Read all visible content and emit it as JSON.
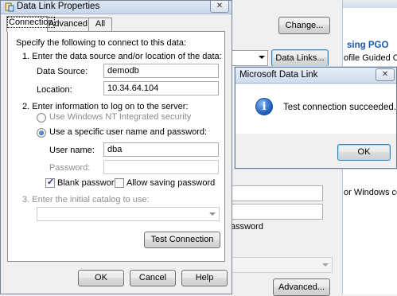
{
  "background": {
    "change_button": "Change...",
    "data_links_button": "Data Links...",
    "advanced_button": "Advanced...",
    "link_heading": "sing PGO",
    "link_text": "ofile Guided Op",
    "link_text_2": "or Windows coc",
    "password_text": "assword"
  },
  "dlp": {
    "title": "Data Link Properties",
    "tabs": [
      "Connection",
      "Advanced",
      "All"
    ],
    "intro": "Specify the following to connect to this data:",
    "step1": "1. Enter the data source and/or location of the data:",
    "data_source_label": "Data Source:",
    "data_source_value": "demodb",
    "location_label": "Location:",
    "location_value": "10.34.64.104",
    "step2": "2. Enter information to log on to the server:",
    "radio_nt": "Use Windows NT Integrated security",
    "radio_specific": "Use a specific user name and password:",
    "username_label": "User name:",
    "username_value": "dba",
    "password_label": "Password:",
    "password_value": "",
    "blank_password": "Blank password",
    "allow_saving": "Allow saving password",
    "step3": "3. Enter the initial catalog to use:",
    "catalog_value": "",
    "test_button": "Test Connection",
    "ok_button": "OK",
    "cancel_button": "Cancel",
    "help_button": "Help"
  },
  "msgbox": {
    "title": "Microsoft Data Link",
    "message": "Test connection succeeded.",
    "ok_button": "OK",
    "icon": "info-icon"
  }
}
